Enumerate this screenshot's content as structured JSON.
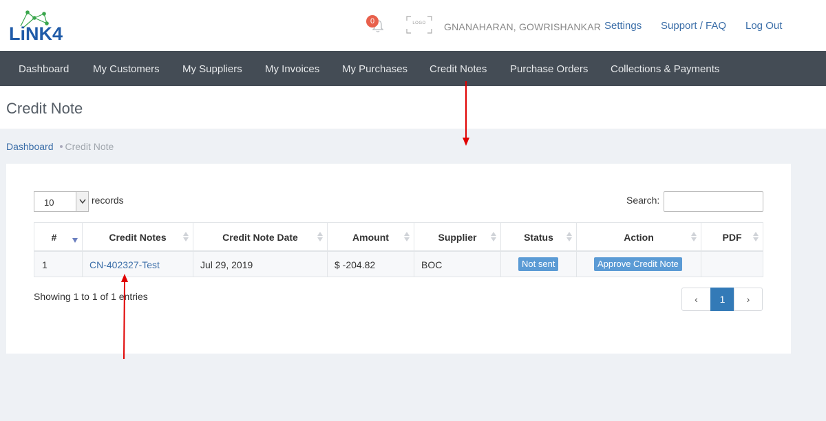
{
  "brand": {
    "name": "LiNK4"
  },
  "header": {
    "notification_count": "0",
    "logo_placeholder": "LOGO",
    "user_name": "GNANAHARAN, GOWRISHANKAR",
    "links": [
      "Settings",
      "Support / FAQ",
      "Log Out"
    ]
  },
  "nav": {
    "items": [
      "Dashboard",
      "My Customers",
      "My Suppliers",
      "My Invoices",
      "My Purchases",
      "Credit Notes",
      "Purchase Orders",
      "Collections & Payments"
    ]
  },
  "page": {
    "title": "Credit Note"
  },
  "breadcrumb": {
    "home": "Dashboard",
    "current": "Credit Note"
  },
  "table_controls": {
    "page_length": "10",
    "records_label": "records",
    "search_label": "Search:",
    "search_value": ""
  },
  "table": {
    "columns": [
      "#",
      "Credit Notes",
      "Credit Note Date",
      "Amount",
      "Supplier",
      "Status",
      "Action",
      "PDF"
    ],
    "rows": [
      {
        "index": "1",
        "credit_note": "CN-402327-Test",
        "date": "Jul 29, 2019",
        "amount": "$ -204.82",
        "supplier": "BOC",
        "status": "Not sent",
        "action": "Approve Credit Note",
        "pdf": ""
      }
    ]
  },
  "footer": {
    "info": "Showing 1 to 1 of 1 entries",
    "pagination": {
      "prev": "‹",
      "current": "1",
      "next": "›"
    }
  },
  "colors": {
    "nav_bg": "#444c55",
    "link": "#3b6ea8",
    "badge": "#5b9bd5",
    "active_page": "#337ab7",
    "annotation_arrow": "#e00000"
  }
}
